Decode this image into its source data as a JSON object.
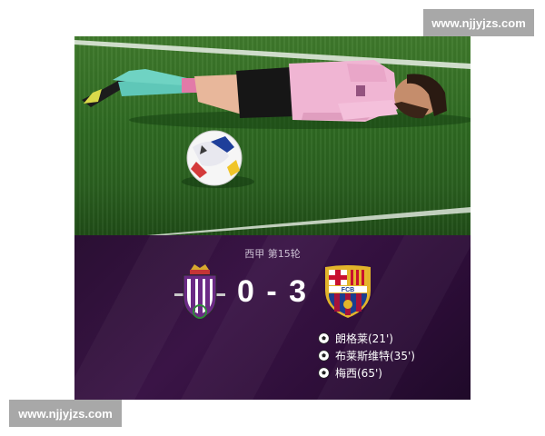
{
  "watermarks": {
    "top": "www.njjyjzs.com",
    "bottom": "www.njjyjzs.com"
  },
  "match": {
    "league": "西甲 第15轮",
    "home_score": "0",
    "separator": "-",
    "away_score": "3",
    "home_crest_icon": "real-valladolid-crest-icon",
    "away_crest_icon": "fc-barcelona-crest-icon",
    "away_crest_text": "FCB",
    "scorers": [
      {
        "icon": "soccer-ball-icon",
        "text": "朗格莱(21')"
      },
      {
        "icon": "soccer-ball-icon",
        "text": "布莱斯维特(35')"
      },
      {
        "icon": "soccer-ball-icon",
        "text": "梅西(65')"
      }
    ]
  },
  "colors": {
    "panel_purple": "#2e0f38",
    "pitch_green": "#33702a",
    "shirt_pink": "#f2b6d6",
    "valladolid_purple": "#6b2a85",
    "barca_blue": "#1b3d8f",
    "barca_red": "#a5123c",
    "barca_gold": "#e2b42a"
  }
}
